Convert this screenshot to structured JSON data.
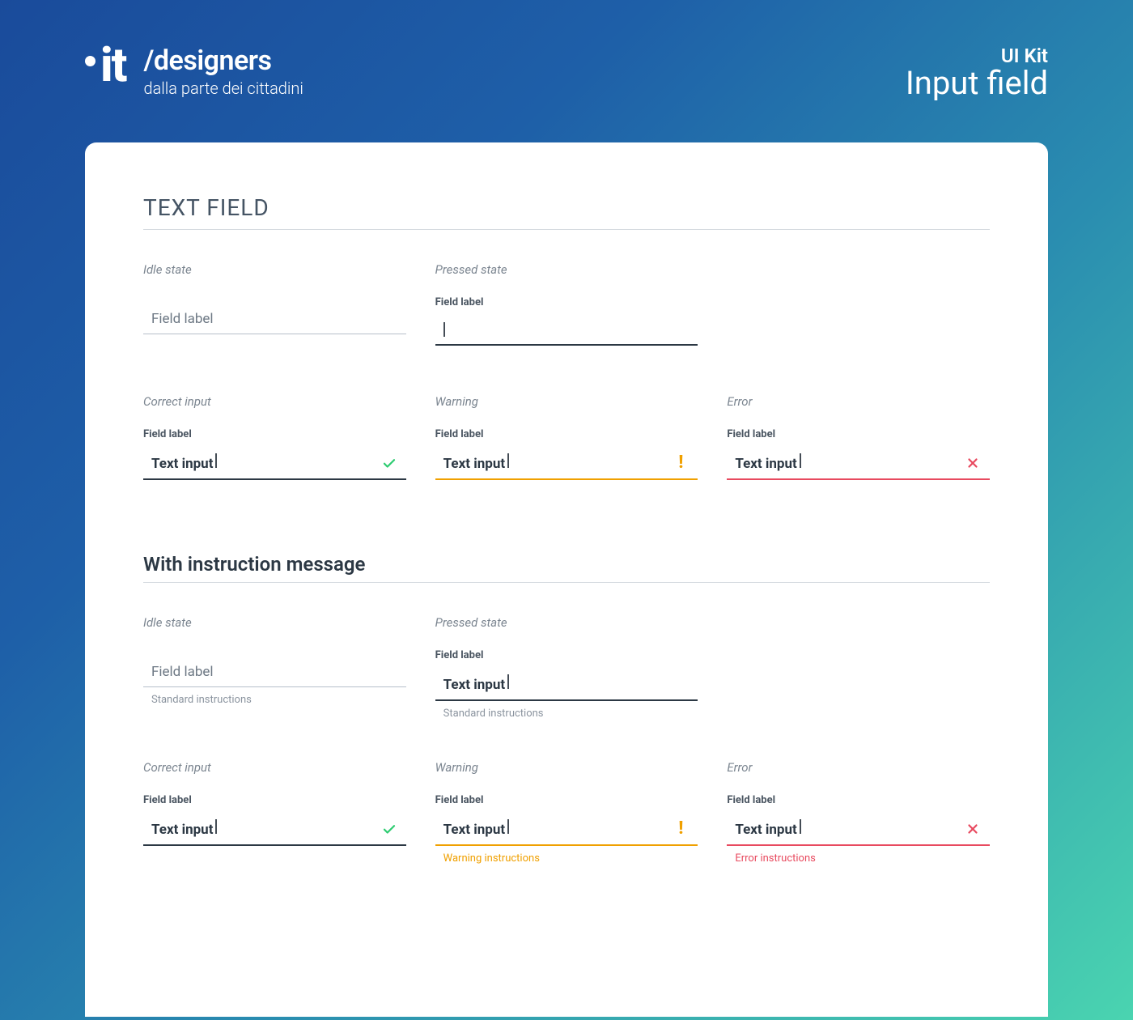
{
  "header": {
    "logo_text": "it",
    "brand_title": "/designers",
    "brand_subtitle": "dalla parte dei cittadini",
    "kit_small": "UI Kit",
    "kit_big": "Input field"
  },
  "section1": {
    "title": "TEXT FIELD",
    "states": {
      "idle": {
        "state_label": "Idle state",
        "field_label": "Field label"
      },
      "pressed": {
        "state_label": "Pressed state",
        "field_label": "Field label"
      },
      "correct": {
        "state_label": "Correct input",
        "field_label": "Field label",
        "value": "Text input"
      },
      "warning": {
        "state_label": "Warning",
        "field_label": "Field label",
        "value": "Text input"
      },
      "error": {
        "state_label": "Error",
        "field_label": "Field label",
        "value": "Text input"
      }
    }
  },
  "section2": {
    "title": "With instruction message",
    "states": {
      "idle": {
        "state_label": "Idle state",
        "field_label": "Field label",
        "instruction": "Standard instructions"
      },
      "pressed": {
        "state_label": "Pressed state",
        "field_label": "Field label",
        "value": "Text input",
        "instruction": "Standard instructions"
      },
      "correct": {
        "state_label": "Correct input",
        "field_label": "Field label",
        "value": "Text input"
      },
      "warning": {
        "state_label": "Warning",
        "field_label": "Field label",
        "value": "Text input",
        "instruction": "Warning instructions"
      },
      "error": {
        "state_label": "Error",
        "field_label": "Field label",
        "value": "Text input",
        "instruction": "Error instructions"
      }
    }
  },
  "colors": {
    "correct": "#2ecc71",
    "warning": "#f0a000",
    "error": "#e84a5f",
    "ink": "#2c3844"
  }
}
